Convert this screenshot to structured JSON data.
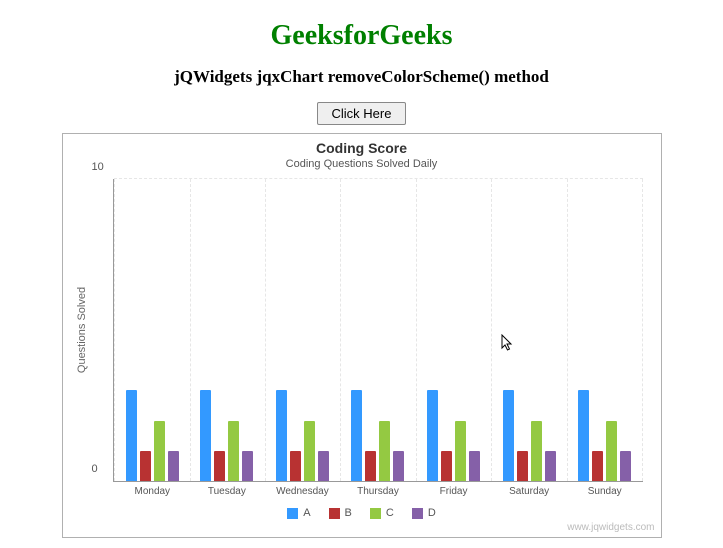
{
  "page": {
    "title": "GeeksforGeeks",
    "subtitle": "jQWidgets jqxChart removeColorScheme() method"
  },
  "button_label": "Click Here",
  "colors": {
    "A": "#3399ff",
    "B": "#b83232",
    "C": "#94c942",
    "D": "#8560a8"
  },
  "chart_data": {
    "type": "bar",
    "title": "Coding Score",
    "subtitle": "Coding Questions Solved Daily",
    "ylabel": "Questions Solved",
    "xlabel": "",
    "ylim": [
      0,
      10
    ],
    "yticks": [
      0,
      10
    ],
    "categories": [
      "Monday",
      "Tuesday",
      "Wednesday",
      "Thursday",
      "Friday",
      "Saturday",
      "Sunday"
    ],
    "series": [
      {
        "name": "A",
        "values": [
          3,
          3,
          3,
          3,
          3,
          3,
          3
        ]
      },
      {
        "name": "B",
        "values": [
          1,
          1,
          1,
          1,
          1,
          1,
          1
        ]
      },
      {
        "name": "C",
        "values": [
          2,
          2,
          2,
          2,
          2,
          2,
          2
        ]
      },
      {
        "name": "D",
        "values": [
          1,
          1,
          1,
          1,
          1,
          1,
          1
        ]
      }
    ]
  },
  "watermark": "www.jqwidgets.com"
}
